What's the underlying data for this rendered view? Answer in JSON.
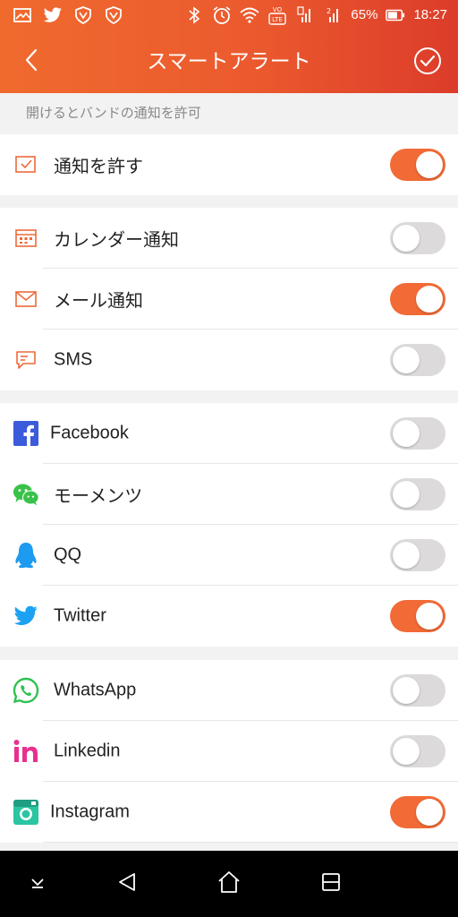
{
  "status_bar": {
    "battery_percent": "65%",
    "time": "18:27",
    "icons_left": [
      "gallery-icon",
      "twitter-icon",
      "vpn-shield-icon",
      "vpn-shield-icon"
    ],
    "icons_right": [
      "bluetooth-icon",
      "alarm-icon",
      "wifi-icon",
      "volte-icon",
      "signal-sim1-icon",
      "signal-sim2-icon",
      "battery-icon"
    ]
  },
  "app_bar": {
    "title": "スマートアラート",
    "back_icon": "chevron-left-icon",
    "confirm_icon": "check-circle-icon"
  },
  "hint_text": "開けるとバンドの通知を許可",
  "groups": [
    {
      "items": [
        {
          "id": "allow",
          "label": "通知を許す",
          "icon": "checkbox-icon",
          "enabled": true
        }
      ]
    },
    {
      "items": [
        {
          "id": "calendar",
          "label": "カレンダー通知",
          "icon": "calendar-icon",
          "enabled": false
        },
        {
          "id": "mail",
          "label": "メール通知",
          "icon": "mail-icon",
          "enabled": true
        },
        {
          "id": "sms",
          "label": "SMS",
          "icon": "sms-icon",
          "enabled": false
        }
      ]
    },
    {
      "items": [
        {
          "id": "facebook",
          "label": "Facebook",
          "icon": "facebook-icon",
          "enabled": false
        },
        {
          "id": "moments",
          "label": "モーメンツ",
          "icon": "wechat-icon",
          "enabled": false
        },
        {
          "id": "qq",
          "label": "QQ",
          "icon": "qq-icon",
          "enabled": false
        },
        {
          "id": "twitter",
          "label": "Twitter",
          "icon": "twitter-icon",
          "enabled": true
        }
      ]
    },
    {
      "items": [
        {
          "id": "whatsapp",
          "label": "WhatsApp",
          "icon": "whatsapp-icon",
          "enabled": false
        },
        {
          "id": "linkedin",
          "label": "Linkedin",
          "icon": "linkedin-icon",
          "enabled": false
        },
        {
          "id": "instagram",
          "label": "Instagram",
          "icon": "instagram-icon",
          "enabled": true
        }
      ]
    }
  ],
  "nav_bar": {
    "icons": [
      "collapse-icon",
      "back-triangle-icon",
      "home-icon",
      "recents-icon"
    ]
  },
  "colors": {
    "header_start": "#f06a2e",
    "header_end": "#dc3c2a",
    "toggle_on": "#f26a35",
    "toggle_off": "#dcdadb",
    "accent_icon": "#ec6a3a"
  }
}
